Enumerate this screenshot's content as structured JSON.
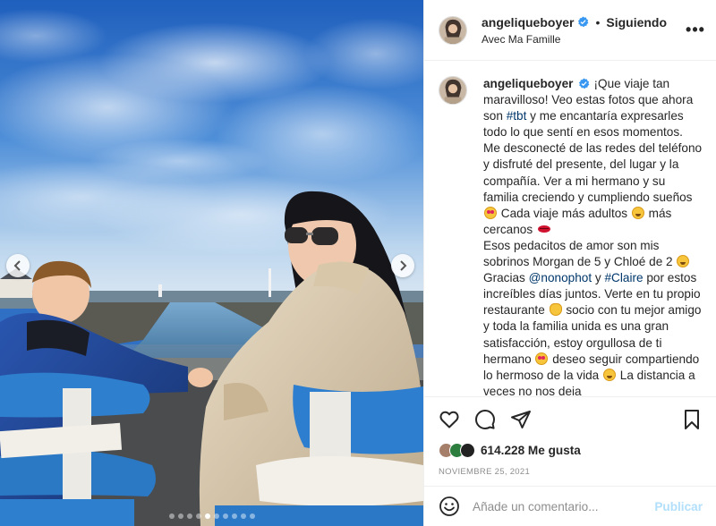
{
  "post": {
    "author": {
      "username": "angeliqueboyer",
      "verified": true,
      "follow_status": "Siguiendo",
      "location": "Avec Ma Famille",
      "separator": "•"
    },
    "more_icon": "more-horizontal-icon",
    "caption": {
      "segments": [
        {
          "type": "text",
          "value": "¡Que viaje tan maravilloso! Veo estas fotos que ahora son "
        },
        {
          "type": "hashtag",
          "value": "#tbt"
        },
        {
          "type": "text",
          "value": " y me encantaría expresarles todo lo que sentí en esos momentos. Me desconecté de las redes del teléfono y disfruté del presente, del lugar y la compañía. Ver a mi hermano y su familia creciendo y cumpliendo sueños "
        },
        {
          "type": "emoji",
          "value": "heart-eyes"
        },
        {
          "type": "text",
          "value": " Cada viaje más adultos "
        },
        {
          "type": "emoji",
          "value": "grin"
        },
        {
          "type": "text",
          "value": " más cercanos "
        },
        {
          "type": "emoji",
          "value": "lips"
        },
        {
          "type": "br"
        },
        {
          "type": "text",
          "value": "Esos pedacitos de amor son mis sobrinos Morgan de 5 y Chloé de 2 "
        },
        {
          "type": "emoji",
          "value": "smile"
        },
        {
          "type": "text",
          "value": " Gracias "
        },
        {
          "type": "hashtag",
          "value": "@nonophot"
        },
        {
          "type": "text",
          "value": " y "
        },
        {
          "type": "hashtag",
          "value": "#Claire"
        },
        {
          "type": "text",
          "value": " por estos increíbles días juntos. Verte en tu propio restaurante "
        },
        {
          "type": "emoji",
          "value": "clap"
        },
        {
          "type": "text",
          "value": " socio con tu mejor amigo y toda la familia unida es una gran satisfacción, estoy orgullosa de ti hermano "
        },
        {
          "type": "emoji",
          "value": "heart-eyes"
        },
        {
          "type": "text",
          "value": " deseo seguir compartiendo lo hermoso de la vida "
        },
        {
          "type": "emoji",
          "value": "smile"
        },
        {
          "type": "text",
          "value": " La distancia a veces no nos deja"
        }
      ]
    },
    "actions": {
      "like_icon": "heart-icon",
      "comment_icon": "comment-icon",
      "share_icon": "send-icon",
      "save_icon": "bookmark-icon"
    },
    "likes": {
      "count": "614.228",
      "label": "Me gusta"
    },
    "date": "NOVIEMBRE 25, 2021",
    "comment_box": {
      "emoji_icon": "smiley-icon",
      "placeholder": "Añade un comentario...",
      "publish_label": "Publicar"
    },
    "carousel": {
      "prev_icon": "chevron-left-icon",
      "next_icon": "chevron-right-icon",
      "slide_count": 10,
      "active_index": 4
    }
  },
  "colors": {
    "link": "#00376b",
    "verified_badge": "#3897f0",
    "publish_disabled": "#b2dffc",
    "secondary_text": "#8e8e8e",
    "border": "#efefef"
  }
}
